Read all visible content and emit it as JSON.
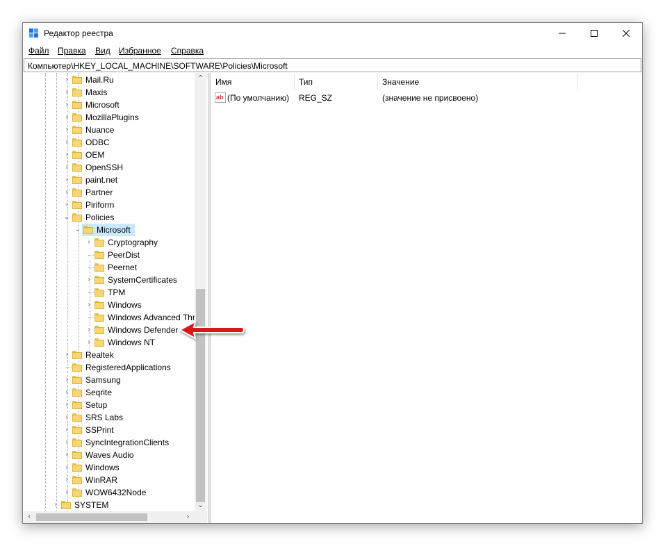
{
  "window": {
    "title": "Редактор реестра",
    "minimize_icon": "minimize-icon",
    "maximize_icon": "maximize-icon",
    "close_icon": "close-icon"
  },
  "menu": [
    "Файл",
    "Правка",
    "Вид",
    "Избранное",
    "Справка"
  ],
  "address": "Компьютер\\HKEY_LOCAL_MACHINE\\SOFTWARE\\Policies\\Microsoft",
  "tree": {
    "software_children_top": [
      "Mail.Ru",
      "Maxis",
      "Microsoft",
      "MozillaPlugins",
      "Nuance",
      "ODBC",
      "OEM",
      "OpenSSH",
      "paint.net",
      "Partner",
      "Piriform",
      "Policies"
    ],
    "policies_child": "Microsoft",
    "microsoft_children": [
      "Cryptography",
      "PeerDist",
      "Peernet",
      "SystemCertificates",
      "TPM",
      "Windows",
      "Windows Advanced Thr",
      "Windows Defender",
      "Windows NT"
    ],
    "software_children_bottom": [
      "Realtek",
      "RegisteredApplications",
      "Samsung",
      "Seqrite",
      "Setup",
      "SRS Labs",
      "SSPrint",
      "SyncIntegrationClients",
      "Waves Audio",
      "Windows",
      "WinRAR",
      "WOW6432Node"
    ],
    "root_sibling": "SYSTEM"
  },
  "list": {
    "columns": [
      "Имя",
      "Тип",
      "Значение"
    ],
    "rows": [
      {
        "name": "(По умолчанию)",
        "type": "REG_SZ",
        "value": "(значение не присвоено)"
      }
    ]
  },
  "colors": {
    "selection": "#cce8ff",
    "folder": "#f6d774",
    "annotation_arrow": "#d9141b"
  }
}
